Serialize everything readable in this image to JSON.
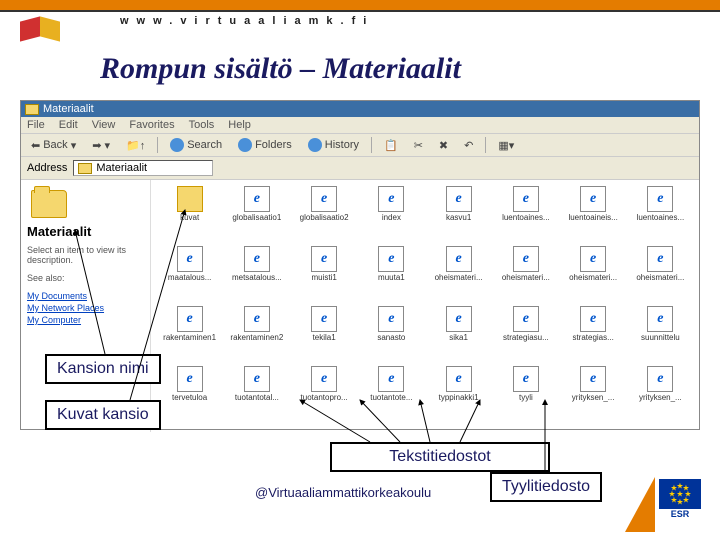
{
  "header": {
    "url_text": "www.virtuaaliamk.fi",
    "slide_title": "Rompun sisältö – Materiaalit"
  },
  "window": {
    "title": "Materiaalit",
    "menu": [
      "File",
      "Edit",
      "View",
      "Favorites",
      "Tools",
      "Help"
    ],
    "toolbar": {
      "back": "Back",
      "search": "Search",
      "folders": "Folders",
      "history": "History"
    },
    "address_label": "Address",
    "address_value": "Materiaalit",
    "left_pane": {
      "title": "Materiaalit",
      "help_text": "Select an item to view its description.",
      "seealso": "See also:",
      "links": [
        "My Documents",
        "My Network Places",
        "My Computer"
      ]
    },
    "files": [
      {
        "name": "kuvat",
        "type": "folder"
      },
      {
        "name": "globalisaatio1",
        "type": "ie"
      },
      {
        "name": "globalisaatio2",
        "type": "ie"
      },
      {
        "name": "index",
        "type": "ie"
      },
      {
        "name": "kasvu1",
        "type": "ie"
      },
      {
        "name": "luentoaines...",
        "type": "ie"
      },
      {
        "name": "luentoaineis...",
        "type": "ie"
      },
      {
        "name": "luentoaines...",
        "type": "ie"
      },
      {
        "name": "maatalous...",
        "type": "ie"
      },
      {
        "name": "metsatalous...",
        "type": "ie"
      },
      {
        "name": "muisti1",
        "type": "ie"
      },
      {
        "name": "muuta1",
        "type": "ie"
      },
      {
        "name": "oheismateri...",
        "type": "ie"
      },
      {
        "name": "oheismateri...",
        "type": "ie"
      },
      {
        "name": "oheismateri...",
        "type": "ie"
      },
      {
        "name": "oheismateri...",
        "type": "ie"
      },
      {
        "name": "rakentaminen1",
        "type": "ie"
      },
      {
        "name": "rakentaminen2",
        "type": "ie"
      },
      {
        "name": "tekila1",
        "type": "ie"
      },
      {
        "name": "sanasto",
        "type": "ie"
      },
      {
        "name": "sika1",
        "type": "ie"
      },
      {
        "name": "strategiasu...",
        "type": "ie"
      },
      {
        "name": "strategias...",
        "type": "ie"
      },
      {
        "name": "suunnittelu",
        "type": "ie"
      },
      {
        "name": "tervetuloa",
        "type": "ie"
      },
      {
        "name": "tuotantotal...",
        "type": "ie"
      },
      {
        "name": "tuotantopro...",
        "type": "ie"
      },
      {
        "name": "tuotantote...",
        "type": "ie"
      },
      {
        "name": "typpinakki1",
        "type": "ie"
      },
      {
        "name": "tyyli",
        "type": "ie"
      },
      {
        "name": "yrityksen_...",
        "type": "ie"
      },
      {
        "name": "yrityksen_...",
        "type": "ie"
      }
    ]
  },
  "callouts": {
    "c1": "Kansion nimi",
    "c2": "Kuvat kansio",
    "c3": "Tekstitiedostot",
    "c4": "Tyylitiedosto"
  },
  "footer": {
    "copyright": "@Virtuaaliammattikorkeakoulu",
    "esr": "ESR"
  }
}
